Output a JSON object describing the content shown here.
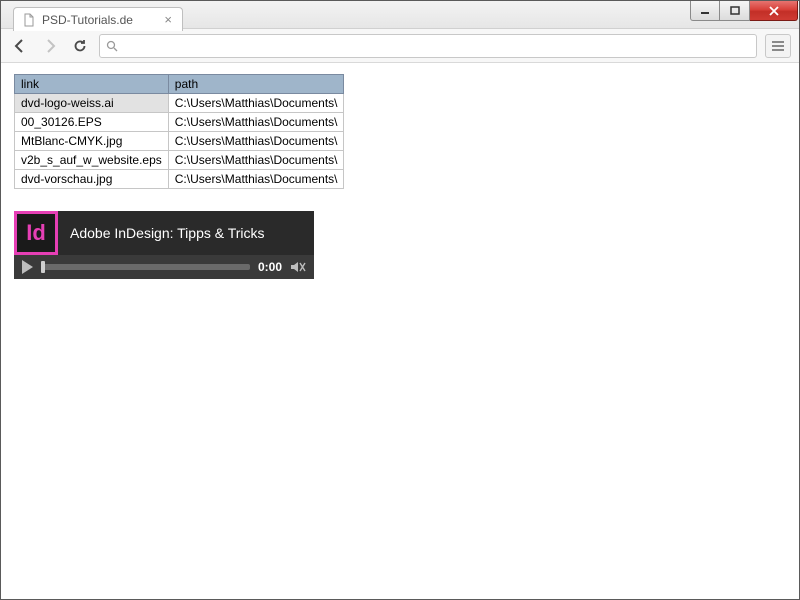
{
  "tab": {
    "title": "PSD-Tutorials.de"
  },
  "omnibox": {
    "value": ""
  },
  "table": {
    "headers": {
      "link": "link",
      "path": "path"
    },
    "rows": [
      {
        "link": "dvd-logo-weiss.ai",
        "path": "C:\\Users\\Matthias\\Documents\\",
        "selected": true
      },
      {
        "link": "00_30126.EPS",
        "path": "C:\\Users\\Matthias\\Documents\\",
        "selected": false
      },
      {
        "link": "MtBlanc-CMYK.jpg",
        "path": "C:\\Users\\Matthias\\Documents\\",
        "selected": false
      },
      {
        "link": "v2b_s_auf_w_website.eps",
        "path": "C:\\Users\\Matthias\\Documents\\",
        "selected": false
      },
      {
        "link": "dvd-vorschau.jpg",
        "path": "C:\\Users\\Matthias\\Documents\\",
        "selected": false
      }
    ]
  },
  "video": {
    "badge": "Id",
    "title": "Adobe InDesign: Tipps & Tricks",
    "time": "0:00"
  }
}
